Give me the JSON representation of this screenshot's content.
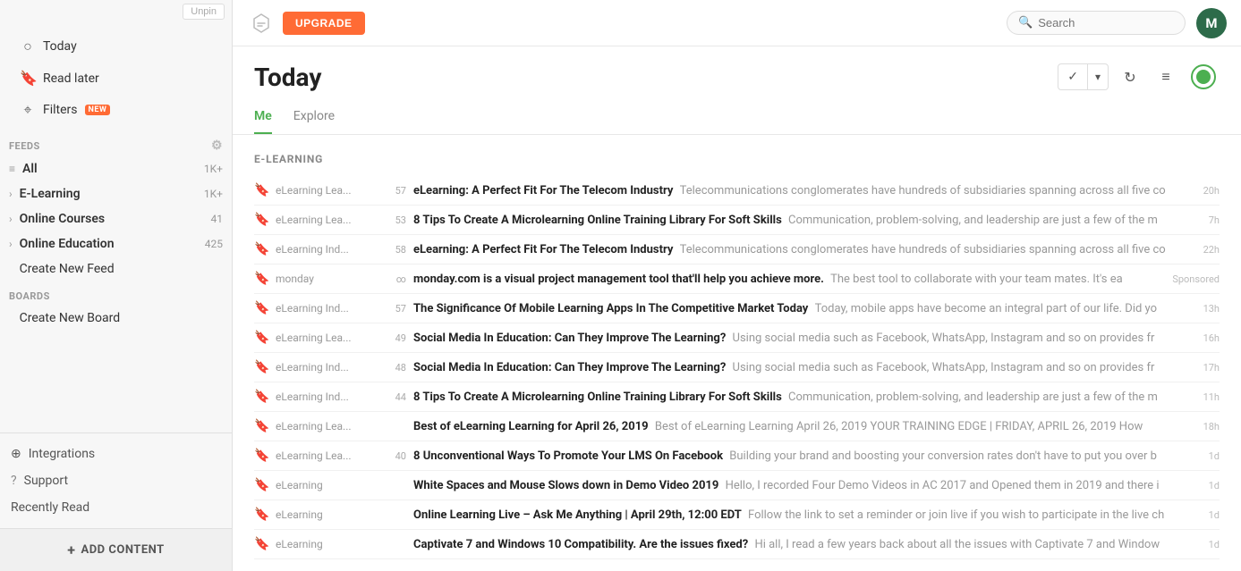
{
  "sidebar": {
    "unpin_label": "Unpin",
    "nav": [
      {
        "id": "today",
        "label": "Today",
        "icon": "○"
      },
      {
        "id": "read-later",
        "label": "Read later",
        "icon": "🔖"
      },
      {
        "id": "filters",
        "label": "Filters",
        "icon": "⌖",
        "badge": "NEW"
      }
    ],
    "feeds_section_label": "FEEDS",
    "feeds": [
      {
        "id": "all",
        "label": "All",
        "count": "1K+",
        "bold": true
      },
      {
        "id": "e-learning",
        "label": "E-Learning",
        "count": "1K+",
        "bold": true,
        "expand": true
      },
      {
        "id": "online-courses",
        "label": "Online Courses",
        "count": "41",
        "bold": true,
        "expand": true
      },
      {
        "id": "online-education",
        "label": "Online Education",
        "count": "425",
        "bold": true,
        "expand": true
      },
      {
        "id": "create-new-feed",
        "label": "Create New Feed",
        "bold": false
      }
    ],
    "boards_section_label": "BOARDS",
    "boards": [
      {
        "id": "create-new-board",
        "label": "Create New Board"
      }
    ],
    "util_items": [
      {
        "id": "integrations",
        "label": "Integrations",
        "icon": "⊕"
      },
      {
        "id": "support",
        "label": "Support",
        "icon": "?"
      },
      {
        "id": "recently-read",
        "label": "Recently Read"
      }
    ],
    "add_content_label": "ADD CONTENT"
  },
  "topbar": {
    "upgrade_label": "UPGRADE",
    "search_placeholder": "Search",
    "avatar_letter": "M"
  },
  "main": {
    "page_title": "Today",
    "tabs": [
      {
        "id": "me",
        "label": "Me",
        "active": true
      },
      {
        "id": "explore",
        "label": "Explore",
        "active": false
      }
    ],
    "section_label": "E-LEARNING",
    "articles": [
      {
        "source": "eLearning Lea...",
        "count": "57",
        "title": "eLearning: A Perfect Fit For The Telecom Industry",
        "snippet": "Telecommunications conglomerates have hundreds of subsidiaries spanning across all five co",
        "time": "20h",
        "sponsored": false
      },
      {
        "source": "eLearning Lea...",
        "count": "53",
        "title": "8 Tips To Create A Microlearning Online Training Library For Soft Skills",
        "snippet": "Communication, problem-solving, and leadership are just a few of the m",
        "time": "7h",
        "sponsored": false
      },
      {
        "source": "eLearning Ind...",
        "count": "58",
        "title": "eLearning: A Perfect Fit For The Telecom Industry",
        "snippet": "Telecommunications conglomerates have hundreds of subsidiaries spanning across all five co",
        "time": "22h",
        "sponsored": false
      },
      {
        "source": "monday",
        "count": "∞",
        "title": "monday.com is a visual project management tool that'll help you achieve more.",
        "snippet": "The best tool to collaborate with your team mates. It's ea",
        "time": "",
        "sponsored": true
      },
      {
        "source": "eLearning Ind...",
        "count": "57",
        "title": "The Significance Of Mobile Learning Apps In The Competitive Market Today",
        "snippet": "Today, mobile apps have become an integral part of our life. Did yo",
        "time": "13h",
        "sponsored": false
      },
      {
        "source": "eLearning Lea...",
        "count": "49",
        "title": "Social Media In Education: Can They Improve The Learning?",
        "snippet": "Using social media such as Facebook, WhatsApp, Instagram and so on provides fr",
        "time": "16h",
        "sponsored": false
      },
      {
        "source": "eLearning Ind...",
        "count": "48",
        "title": "Social Media In Education: Can They Improve The Learning?",
        "snippet": "Using social media such as Facebook, WhatsApp, Instagram and so on provides fr",
        "time": "17h",
        "sponsored": false
      },
      {
        "source": "eLearning Ind...",
        "count": "44",
        "title": "8 Tips To Create A Microlearning Online Training Library For Soft Skills",
        "snippet": "Communication, problem-solving, and leadership are just a few of the m",
        "time": "11h",
        "sponsored": false
      },
      {
        "source": "eLearning Lea...",
        "count": "",
        "title": "Best of eLearning Learning for April 26, 2019",
        "snippet": "Best of eLearning Learning April 26, 2019 YOUR TRAINING EDGE | FRIDAY, APRIL 26, 2019 How",
        "time": "18h",
        "sponsored": false
      },
      {
        "source": "eLearning Lea...",
        "count": "40",
        "title": "8 Unconventional Ways To Promote Your LMS On Facebook",
        "snippet": "Building your brand and boosting your conversion rates don't have to put you over b",
        "time": "1d",
        "sponsored": false
      },
      {
        "source": "eLearning",
        "count": "",
        "title": "White Spaces and Mouse Slows down in Demo Video 2019",
        "snippet": "Hello, I recorded Four Demo Videos in AC 2017 and Opened them in 2019 and there i",
        "time": "1d",
        "sponsored": false
      },
      {
        "source": "eLearning",
        "count": "",
        "title": "Online Learning Live – Ask Me Anything | April 29th, 12:00 EDT",
        "snippet": "Follow the link to set a reminder or join live if you wish to participate in the live ch",
        "time": "1d",
        "sponsored": false
      },
      {
        "source": "eLearning",
        "count": "",
        "title": "Captivate 7 and Windows 10 Compatibility. Are the issues fixed?",
        "snippet": "Hi all, I read a few years back about all the issues with Captivate 7 and Window",
        "time": "1d",
        "sponsored": false
      }
    ]
  }
}
